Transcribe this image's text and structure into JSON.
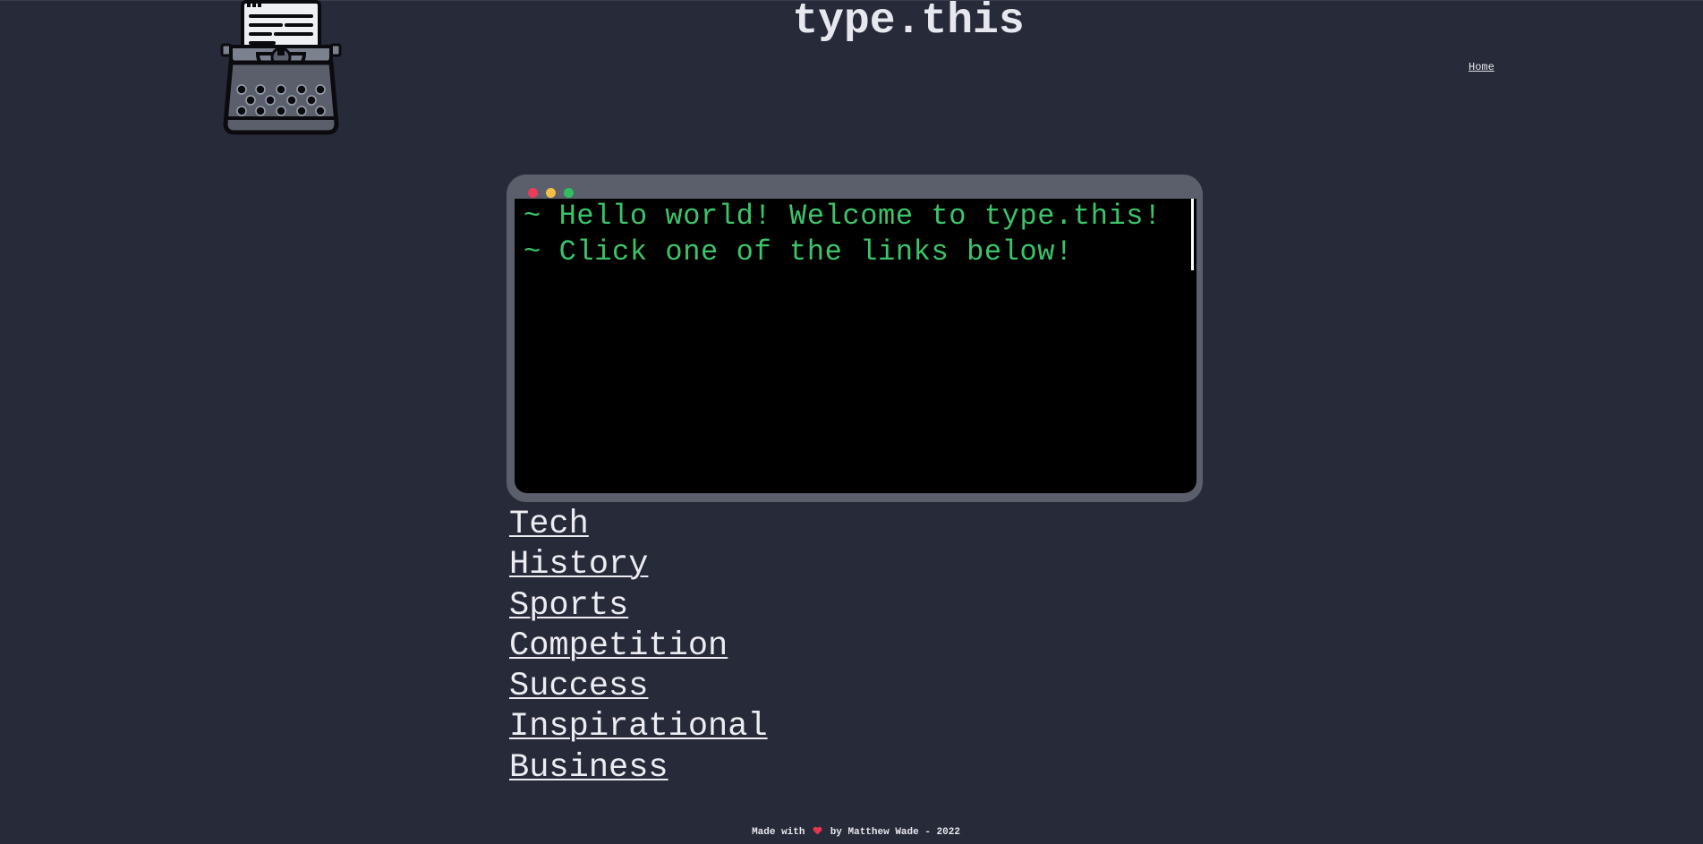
{
  "site": {
    "title": "type.this"
  },
  "nav": {
    "home_label": "Home"
  },
  "terminal": {
    "lines": [
      "~ Hello world! Welcome to type.this!",
      "~ Click one of the links below!"
    ],
    "window_button_colors": [
      "#ef3b5a",
      "#f3bf47",
      "#2fbe61"
    ],
    "text_color": "#3cc46a"
  },
  "categories": [
    "Tech",
    "History",
    "Sports",
    "Competition",
    "Success",
    "Inspirational",
    "Business"
  ],
  "footer": {
    "prefix": "Made with",
    "icon": "heart-icon",
    "suffix": "by Matthew Wade - 2022"
  },
  "colors": {
    "background": "#272a39",
    "terminal_frame": "#5a5f6b",
    "heart": "#e0364f"
  }
}
